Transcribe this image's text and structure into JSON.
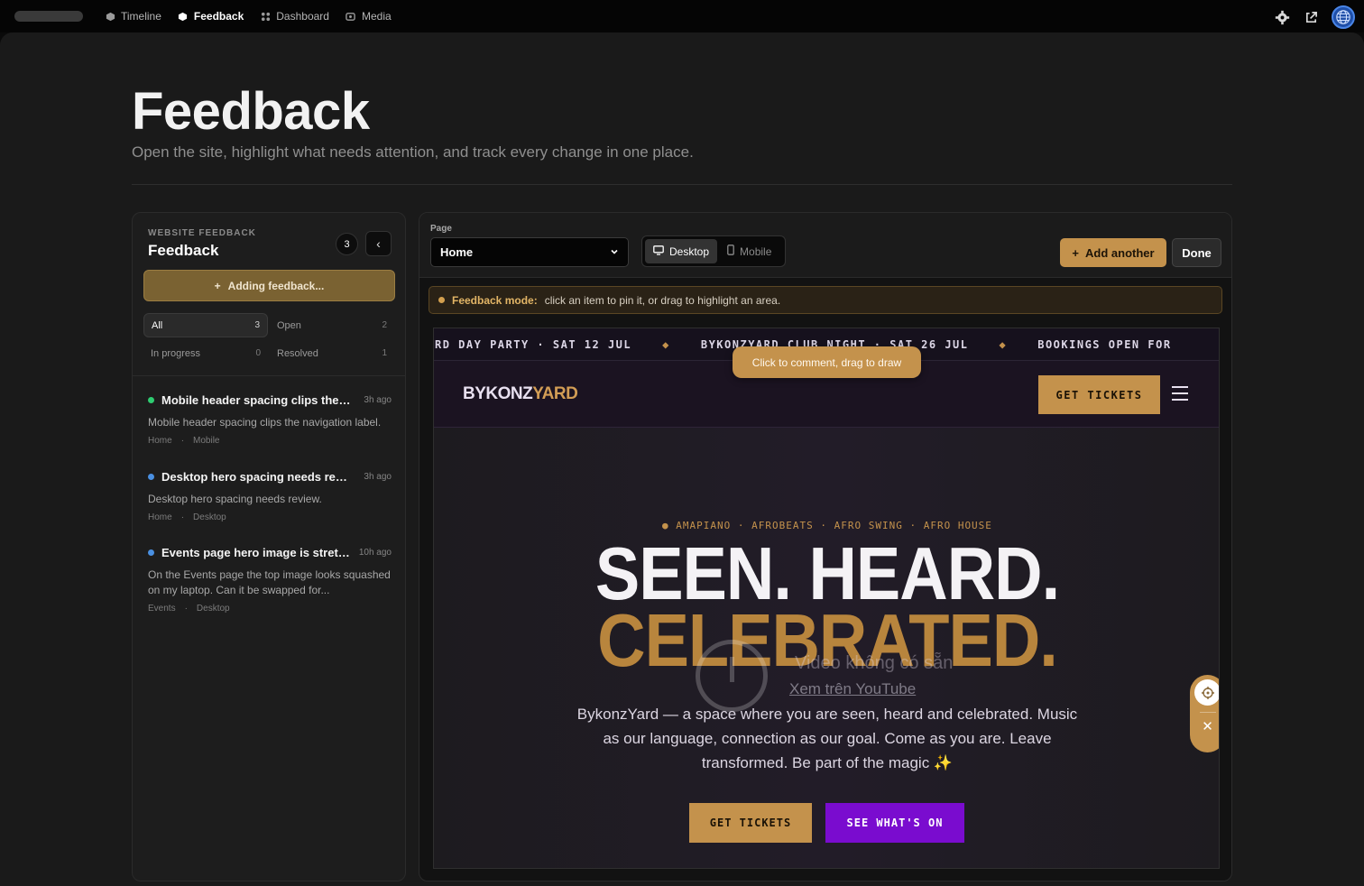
{
  "topbar": {
    "nav": [
      {
        "label": "Timeline",
        "icon": "cube-icon"
      },
      {
        "label": "Feedback",
        "icon": "cube-icon"
      },
      {
        "label": "Dashboard",
        "icon": "dashboard-icon"
      },
      {
        "label": "Media",
        "icon": "media-icon"
      }
    ],
    "active": "Feedback"
  },
  "header": {
    "title": "Feedback",
    "subtitle": "Open the site, highlight what needs attention, and track every change in one place."
  },
  "sidebar": {
    "kicker": "WEBSITE FEEDBACK",
    "title": "Feedback",
    "count": "3",
    "adding_label": "Adding feedback...",
    "filters": [
      {
        "label": "All",
        "count": "3"
      },
      {
        "label": "Open",
        "count": "2"
      },
      {
        "label": "In progress",
        "count": "0"
      },
      {
        "label": "Resolved",
        "count": "1"
      }
    ],
    "items": [
      {
        "title": "Mobile header spacing clips the navigation label.",
        "time": "3h ago",
        "body": "Mobile header spacing clips the navigation label.",
        "page": "Home",
        "device": "Mobile",
        "status_color": "#2ecc71"
      },
      {
        "title": "Desktop hero spacing needs review.",
        "time": "3h ago",
        "body": "Desktop hero spacing needs review.",
        "page": "Home",
        "device": "Desktop",
        "status_color": "#4a90e2"
      },
      {
        "title": "Events page hero image is stretched",
        "time": "10h ago",
        "body": "On the Events page the top image looks squashed on my laptop. Can it be swapped for...",
        "page": "Events",
        "device": "Desktop",
        "status_color": "#4a90e2"
      }
    ]
  },
  "toolbar": {
    "page_label": "Page",
    "page_value": "Home",
    "devices": [
      "Desktop",
      "Mobile"
    ],
    "active_device": "Desktop",
    "add_label": "Add another",
    "done_label": "Done"
  },
  "mode_bar": {
    "label": "Feedback mode:",
    "text": "click an item to pin it, or drag to highlight an area."
  },
  "preview": {
    "ticker": [
      "RD DAY PARTY · SAT 12 JUL",
      "BYKONZYARD CLUB NIGHT · SAT 26 JUL",
      "BOOKINGS OPEN FOR"
    ],
    "tooltip": "Click to comment, drag to draw",
    "logo_a": "BYKONZ",
    "logo_b": "YARD",
    "nav_cta": "GET TICKETS",
    "genres": "● AMAPIANO · AFROBEATS · AFRO SWING · AFRO HOUSE",
    "headline_1": "SEEN. HEARD.",
    "headline_2": "CELEBRATED.",
    "video_error": "Video không có sẵn",
    "video_link": "Xem trên YouTube",
    "copy": "BykonzYard — a space where you are seen, heard and celebrated. Music as our language, connection as our goal. Come as you are. Leave transformed. Be part of the magic ✨",
    "cta_primary": "GET TICKETS",
    "cta_secondary": "SEE WHAT'S ON"
  },
  "colors": {
    "accent": "#c4924c",
    "purple": "#7a0ccf",
    "open_dot": "#2ecc71",
    "info_dot": "#4a90e2"
  }
}
